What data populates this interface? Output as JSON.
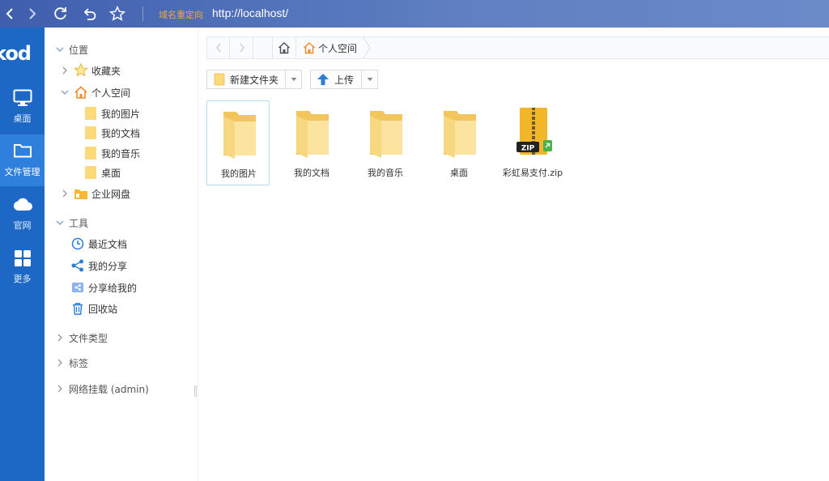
{
  "browser": {
    "redirect_label": "域名重定向",
    "url": "http://localhost/",
    "icons": [
      "back-icon",
      "forward-icon",
      "refresh-icon",
      "undo-icon",
      "star-icon"
    ]
  },
  "rail": {
    "logo_text": "kod",
    "items": [
      {
        "label": "桌面",
        "icon": "monitor-icon"
      },
      {
        "label": "文件管理",
        "icon": "folder-icon",
        "active": true
      },
      {
        "label": "官网",
        "icon": "cloud-icon"
      },
      {
        "label": "更多",
        "icon": "grid-icon"
      }
    ],
    "colors": {
      "background": "#1c68c4",
      "active": "#2f80dc"
    }
  },
  "tree": {
    "location_section": "位置",
    "favorites": "收藏夹",
    "personal_space": "个人空间",
    "children": [
      "我的图片",
      "我的文档",
      "我的音乐",
      "桌面"
    ],
    "enterprise_drive": "企业网盘",
    "tools_section": "工具",
    "tools": [
      "最近文档",
      "我的分享",
      "分享给我的",
      "回收站"
    ],
    "file_types": "文件类型",
    "tags": "标签",
    "network_mount": "网络挂载 (admin)"
  },
  "main": {
    "breadcrumb": "个人空间",
    "new_folder_label": "新建文件夹",
    "upload_label": "上传",
    "files": [
      {
        "name": "我的图片",
        "type": "folder",
        "selected": true
      },
      {
        "name": "我的文档",
        "type": "folder"
      },
      {
        "name": "我的音乐",
        "type": "folder"
      },
      {
        "name": "桌面",
        "type": "folder"
      },
      {
        "name": "彩虹易支付.zip",
        "type": "zip",
        "badge": "ZIP"
      }
    ]
  }
}
